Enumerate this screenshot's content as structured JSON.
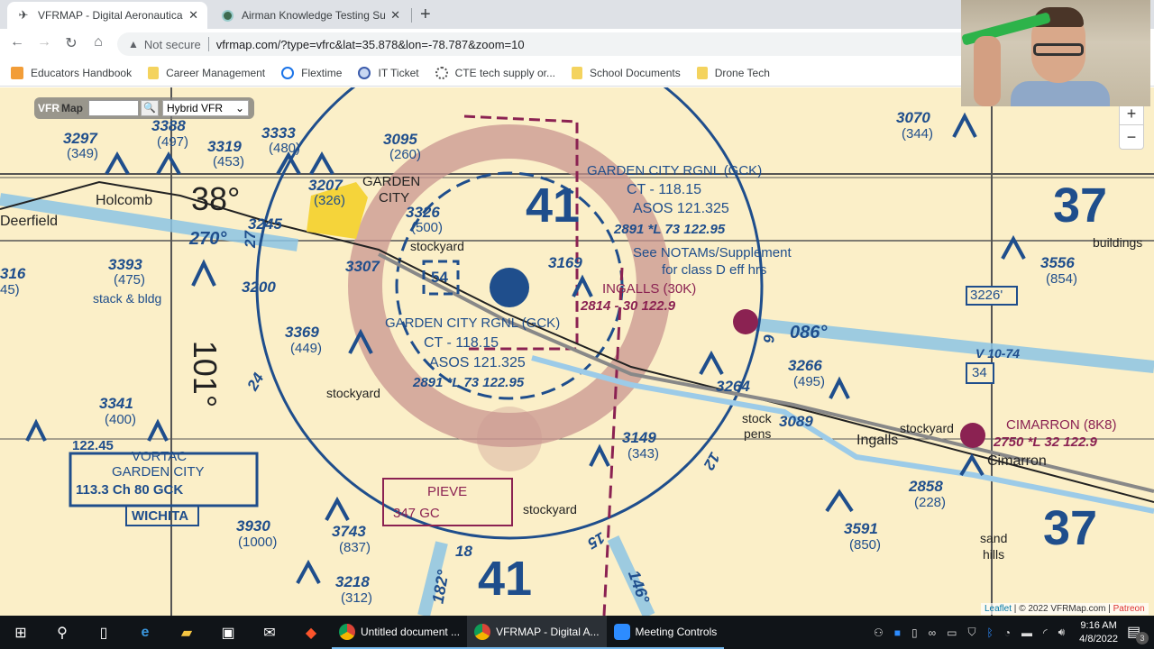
{
  "browser": {
    "tabs": [
      {
        "label": "VFRMAP - Digital Aeronautical Ch",
        "icon": "airplane-icon",
        "active": true
      },
      {
        "label": "Airman Knowledge Testing Supp",
        "icon": "faa-seal-icon",
        "active": false
      }
    ],
    "new_tab": "+",
    "close": "✕",
    "address": {
      "security_label": "Not secure",
      "url": "vfrmap.com/?type=vfrc&lat=35.878&lon=-78.787&zoom=10"
    },
    "bookmarks": [
      {
        "label": "Educators Handbook",
        "icon": "orange-app-icon"
      },
      {
        "label": "Career Management",
        "icon": "folder-icon"
      },
      {
        "label": "Flextime",
        "icon": "flextime-icon"
      },
      {
        "label": "IT Ticket",
        "icon": "it-ticket-icon"
      },
      {
        "label": "CTE tech supply or...",
        "icon": "cte-icon"
      },
      {
        "label": "School Documents",
        "icon": "folder-icon"
      },
      {
        "label": "Drone Tech",
        "icon": "folder-icon"
      }
    ]
  },
  "map_control": {
    "brand_a": "VFR",
    "brand_b": "Map",
    "search_value": "",
    "chart_type": "Hybrid VFR",
    "zoom_in": "+",
    "zoom_out": "−"
  },
  "attribution": {
    "leaflet": "Leaflet",
    "copyright": "© 2022 VFRMap.com",
    "patreon": "Patreon"
  },
  "chart": {
    "airports": [
      {
        "name": "GARDEN CITY RGNL (GCK)",
        "ct": "CT - 118.15",
        "asos": "ASOS 121.325",
        "info": "2891 *L 73 122.95"
      },
      {
        "name": "INGALLS (30K)",
        "info": "2814 - 30 122.9"
      },
      {
        "name": "CIMARRON (8K8)",
        "info": "2750 *L 32 122.9"
      }
    ],
    "notam_note": [
      "See NOTAMs/Supplement",
      "for class D eff hrs"
    ],
    "vortac": {
      "freq_top": "122.45",
      "type": "VORTAC",
      "name": "GARDEN CITY",
      "ident_line": "113.3 Ch 80 GCK",
      "center": "WICHITA"
    },
    "ndb": {
      "name": "PIEVE",
      "line": "347 GC"
    },
    "towns": [
      "Holcomb",
      "Deerfield",
      "GARDEN",
      "CITY",
      "Ingalls",
      "Cimarron"
    ],
    "landmarks": [
      "stockyard",
      "stack & bldg",
      "buildings",
      "stock",
      "pens",
      "sand",
      "hills"
    ],
    "grid_labels": [
      "38°",
      "101°",
      "41",
      "37"
    ],
    "radials": [
      "270°",
      "086°",
      "182°",
      "146°"
    ],
    "airway": "V 10-74",
    "compass_numbers": [
      "24",
      "27",
      "6",
      "12",
      "15",
      "18"
    ],
    "route_shields": [
      "54",
      "34",
      "3226'"
    ],
    "obstacles": [
      {
        "msl": "3297",
        "agl": "(349)"
      },
      {
        "msl": "3388",
        "agl": "(497)"
      },
      {
        "msl": "3319",
        "agl": "(453)"
      },
      {
        "msl": "3333",
        "agl": "(480)"
      },
      {
        "msl": "3095",
        "agl": "(260)"
      },
      {
        "msl": "3207",
        "agl": "(326)"
      },
      {
        "msl": "3326",
        "agl": "(500)"
      },
      {
        "msl": "3245",
        "agl": ""
      },
      {
        "msl": "3307",
        "agl": ""
      },
      {
        "msl": "3393",
        "agl": "(475)"
      },
      {
        "msl": "3200",
        "agl": ""
      },
      {
        "msl": "3369",
        "agl": "(449)"
      },
      {
        "msl": "3169",
        "agl": ""
      },
      {
        "msl": "3070",
        "agl": "(344)"
      },
      {
        "msl": "3556",
        "agl": "(854)"
      },
      {
        "msl": "3266",
        "agl": "(495)"
      },
      {
        "msl": "3264",
        "agl": ""
      },
      {
        "msl": "3089",
        "agl": ""
      },
      {
        "msl": "3341",
        "agl": "(400)"
      },
      {
        "msl": "3149",
        "agl": "(343)"
      },
      {
        "msl": "3930",
        "agl": "(1000)"
      },
      {
        "msl": "3743",
        "agl": "(837)"
      },
      {
        "msl": "3218",
        "agl": "(312)"
      },
      {
        "msl": "3591",
        "agl": "(850)"
      },
      {
        "msl": "2858",
        "agl": "(228)"
      },
      {
        "msl": "316",
        "agl": "45)"
      }
    ]
  },
  "taskbar": {
    "apps": [
      {
        "label": "Untitled document ...",
        "icon": "chrome-icon"
      },
      {
        "label": "VFRMAP - Digital A...",
        "icon": "chrome-icon",
        "active": true
      },
      {
        "label": "Meeting Controls",
        "icon": "zoom-icon"
      }
    ],
    "time": "9:16 AM",
    "date": "4/8/2022",
    "notifications": "3"
  }
}
